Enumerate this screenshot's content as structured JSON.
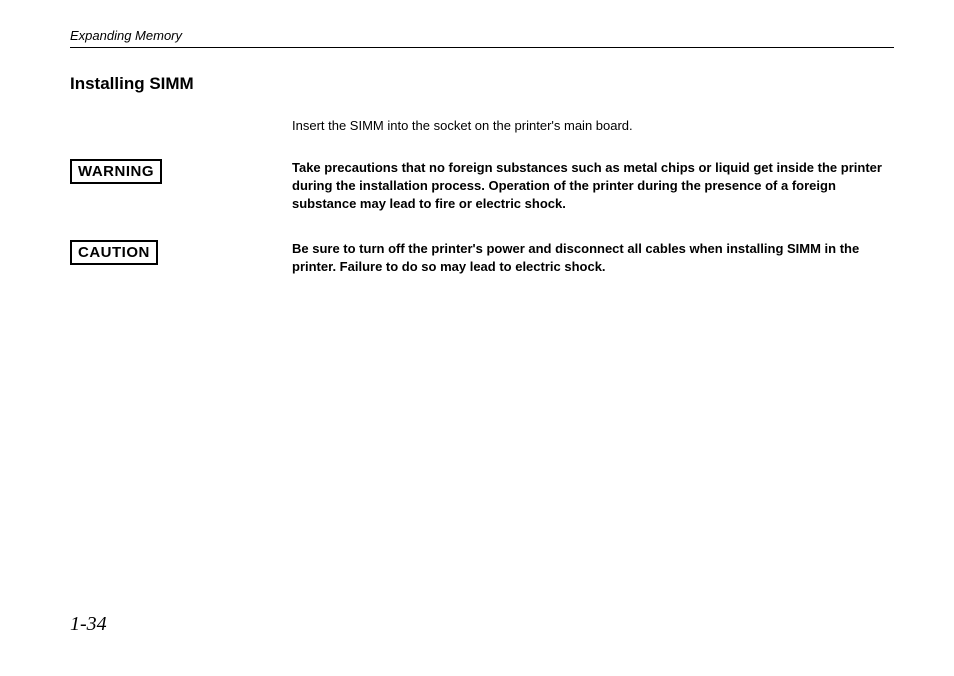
{
  "header": {
    "section": "Expanding Memory"
  },
  "title": "Installing SIMM",
  "intro": "Insert the SIMM into the socket on the printer's main board.",
  "warning": {
    "label": "WARNING",
    "text": "Take precautions that no foreign substances such as metal chips or liquid get inside the printer during the installation process.  Operation of the printer during the presence of a foreign substance may lead to fire or electric shock."
  },
  "caution": {
    "label": "CAUTION",
    "text": "Be sure to turn off the printer's power and disconnect all cables when installing SIMM in the printer.  Failure to do so may lead to electric shock."
  },
  "pageNumber": "1-34"
}
